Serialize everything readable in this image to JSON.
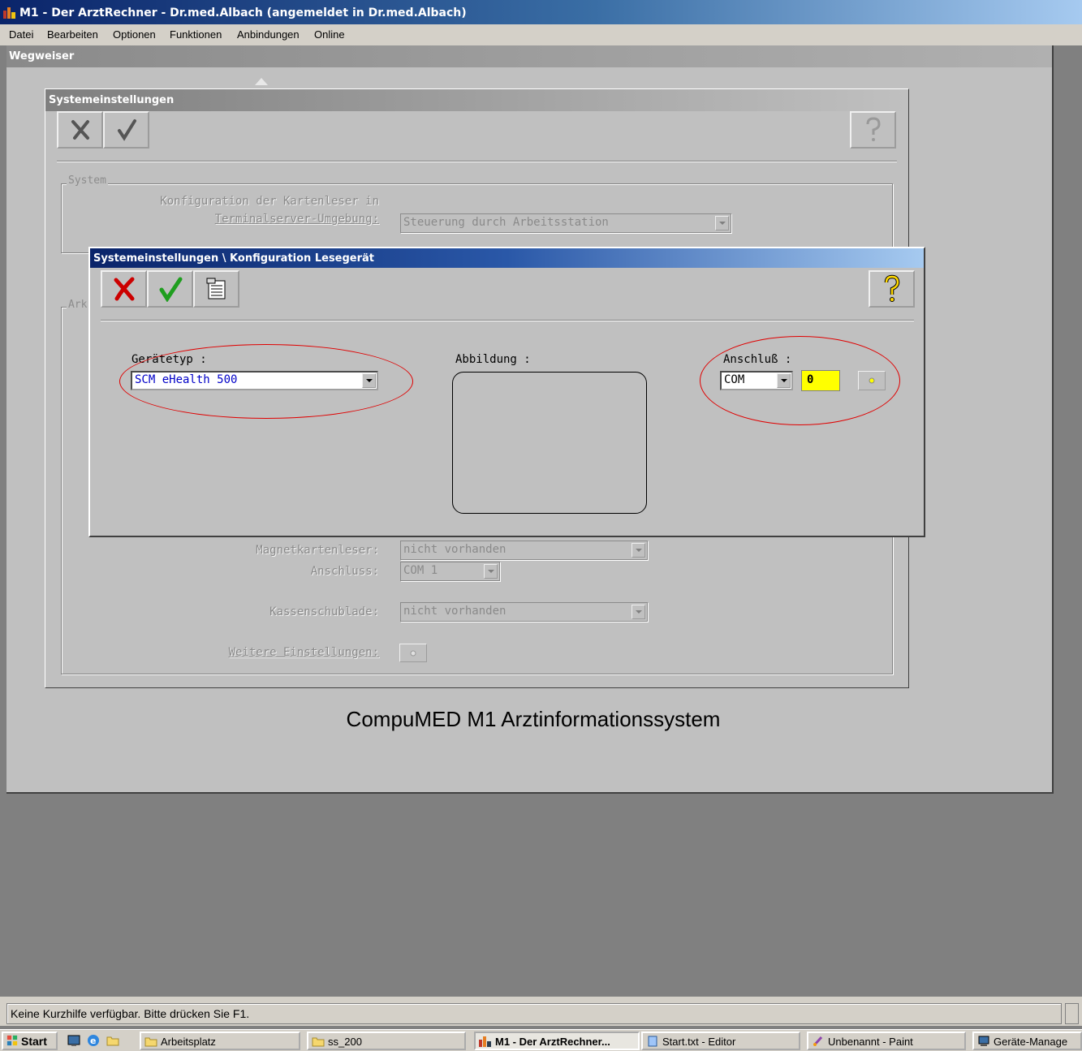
{
  "window": {
    "title": "M1 - Der ArztRechner  -  Dr.med.Albach (angemeldet in Dr.med.Albach)",
    "icon": "app-icon"
  },
  "menu": [
    "Datei",
    "Bearbeiten",
    "Optionen",
    "Funktionen",
    "Anbindungen",
    "Online"
  ],
  "mdi": {
    "title": "Wegweiser",
    "footer": "CompuMED M1 Arztinformationssystem"
  },
  "background_dialog": {
    "title": "Systemeinstellungen",
    "group_system": "System",
    "group_other": "Ark",
    "terminal_label_line1": "Konfiguration der Kartenleser in",
    "terminal_label_line2": "Terminalserver-Umgebung:",
    "terminal_value": "Steuerung durch Arbeitsstation",
    "magnet_label": "Magnetkartenleser:",
    "magnet_value": "nicht vorhanden",
    "anschluss_label": "Anschluss:",
    "anschluss_value": "COM 1",
    "kasse_label": "Kassenschublade:",
    "kasse_value": "nicht vorhanden",
    "weitere_label": "Weitere Einstellungen:"
  },
  "foreground_dialog": {
    "title": "Systemeinstellungen \\ Konfiguration Lesegerät",
    "geraetetyp_label": "Gerätetyp :",
    "geraetetyp_value": "SCM eHealth 500",
    "abbildung_label": "Abbildung :",
    "anschluss_label": "Anschluß :",
    "anschluss_type": "COM",
    "anschluss_port": "0"
  },
  "status": {
    "text": "Keine Kurzhilfe verfügbar. Bitte drücken Sie F1."
  },
  "taskbar": {
    "start": "Start",
    "tasks": [
      "Arbeitsplatz",
      "ss_200",
      "M1 - Der ArztRechner...",
      "Start.txt - Editor",
      "Unbenannt - Paint",
      "Geräte-Manage"
    ]
  },
  "colors": {
    "accent_title": "#0a246a",
    "highlight_input": "#ffff00",
    "annotation": "#e00000",
    "combo_text": "#0000c8"
  }
}
